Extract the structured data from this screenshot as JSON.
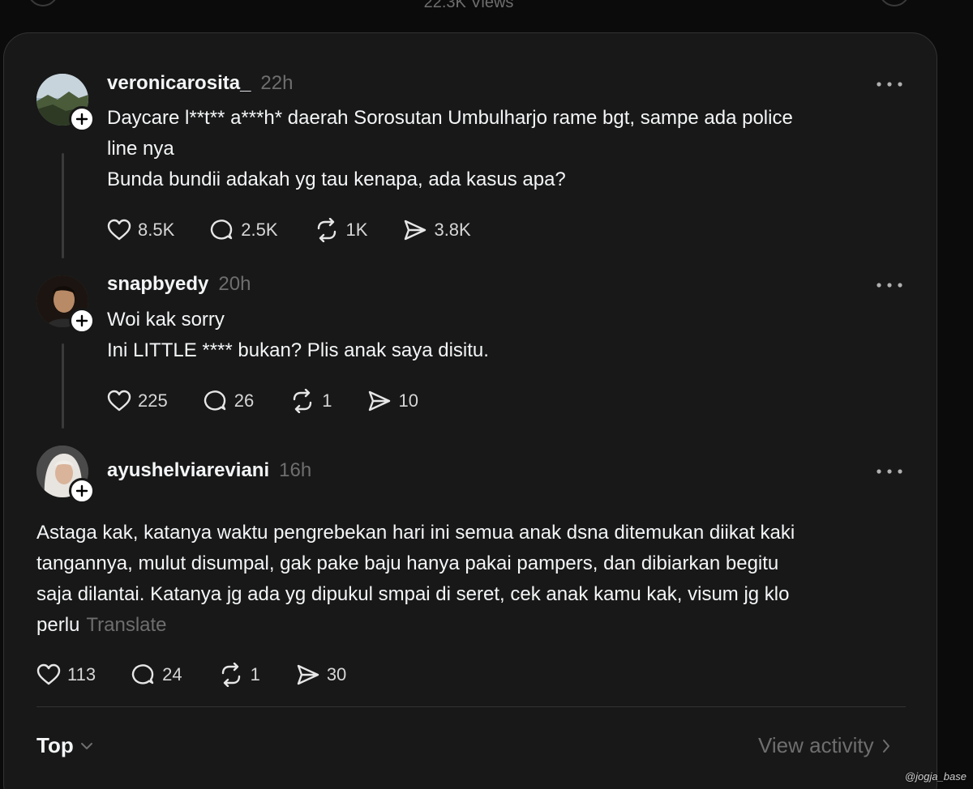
{
  "top": {
    "views": "22.3K Views"
  },
  "posts": [
    {
      "username": "veronicarosita_",
      "time": "22h",
      "lines": [
        "Daycare l**t** a***h* daerah Sorosutan Umbulharjo rame bgt, sampe ada police",
        "line nya",
        "Bunda bundii adakah yg tau kenapa, ada kasus apa?"
      ],
      "likes": "8.5K",
      "replies": "2.5K",
      "reposts": "1K",
      "shares": "3.8K"
    },
    {
      "username": "snapbyedy",
      "time": "20h",
      "lines": [
        "Woi kak sorry",
        "Ini LITTLE **** bukan? Plis anak saya disitu."
      ],
      "likes": "225",
      "replies": "26",
      "reposts": "1",
      "shares": "10"
    },
    {
      "username": "ayushelviareviani",
      "time": "16h",
      "lines": [
        "Astaga kak, katanya waktu pengrebekan hari ini semua anak dsna ditemukan diikat kaki",
        "tangannya, mulut disumpal, gak pake baju hanya pakai pampers, dan dibiarkan begitu",
        "saja dilantai. Katanya jg ada yg dipukul smpai di seret, cek anak kamu kak, visum jg klo",
        "perlu"
      ],
      "translate": "Translate",
      "likes": "113",
      "replies": "24",
      "reposts": "1",
      "shares": "30"
    }
  ],
  "footer": {
    "sort_label": "Top",
    "view_activity": "View activity"
  },
  "watermark": "@jogja_base"
}
